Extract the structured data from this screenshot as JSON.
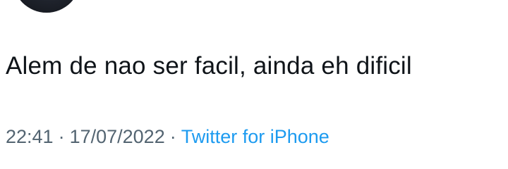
{
  "tweet": {
    "text": "Alem de nao ser facil, ainda eh dificil",
    "time": "22:41",
    "separator": "·",
    "date": "17/07/2022",
    "source": "Twitter for iPhone"
  },
  "colors": {
    "text": "#0f1419",
    "meta": "#536471",
    "link": "#1d9bf0"
  }
}
